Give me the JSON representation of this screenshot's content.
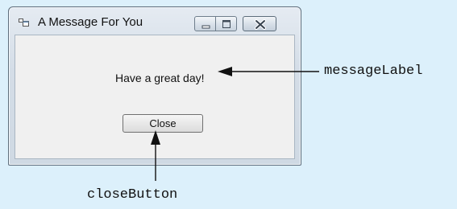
{
  "window": {
    "title": "A Message For You",
    "app_icon": "window-form-icon",
    "controls": {
      "minimize": "minimize-icon",
      "maximize": "maximize-icon",
      "close": "close-icon"
    }
  },
  "form": {
    "message_text": "Have a great day!",
    "close_label": "Close"
  },
  "callouts": {
    "message_label": "messageLabel",
    "close_button": "closeButton"
  },
  "colors": {
    "background": "#dcf0fb",
    "client_area": "#f0f0f0",
    "window_frame": "#d4dde7",
    "close_control": "#c5cfdb"
  }
}
